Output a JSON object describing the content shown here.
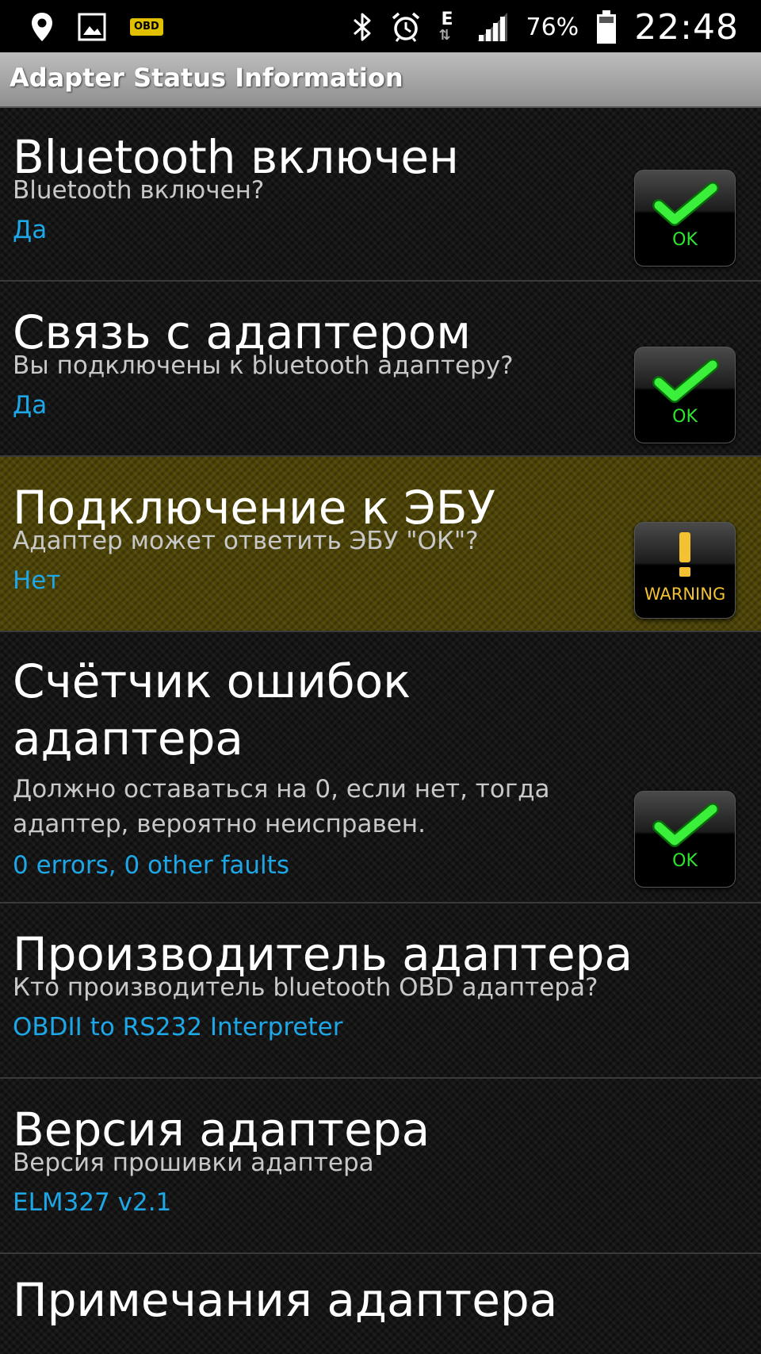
{
  "status_bar": {
    "obd_label": "OBD",
    "battery_percent": "76%",
    "time": "22:48",
    "network_letter": "E"
  },
  "title_bar": {
    "title": "Adapter Status Information"
  },
  "items": [
    {
      "title": "Bluetooth включен",
      "subtitle": "Bluetooth включен?",
      "value": "Да",
      "status": "OK"
    },
    {
      "title": "Связь с адаптером",
      "subtitle": "Вы подключены к bluetooth адаптеру?",
      "value": "Да",
      "status": "OK"
    },
    {
      "title": "Подключение к ЭБУ",
      "subtitle": "Адаптер может ответить ЭБУ \"ОК\"?",
      "value": "Нет",
      "status": "WARNING"
    },
    {
      "title": "Счётчик ошибок адаптера",
      "subtitle": "Должно оставаться на 0, если нет, тогда адаптер, вероятно неисправен.",
      "value": "0 errors, 0 other faults",
      "status": "OK"
    },
    {
      "title": "Производитель адаптера",
      "subtitle": "Кто производитель bluetooth OBD адаптера?",
      "value": "OBDII to RS232 Interpreter"
    },
    {
      "title": "Версия адаптера",
      "subtitle": "Версия прошивки адаптера",
      "value": "ELM327 v2.1"
    },
    {
      "title": "Примечания адаптера"
    }
  ],
  "colors": {
    "value_text": "#1ea7e6",
    "ok_green": "#2ee62e",
    "warning_yellow": "#f2c230",
    "warning_row_bg": "#4c4305"
  }
}
